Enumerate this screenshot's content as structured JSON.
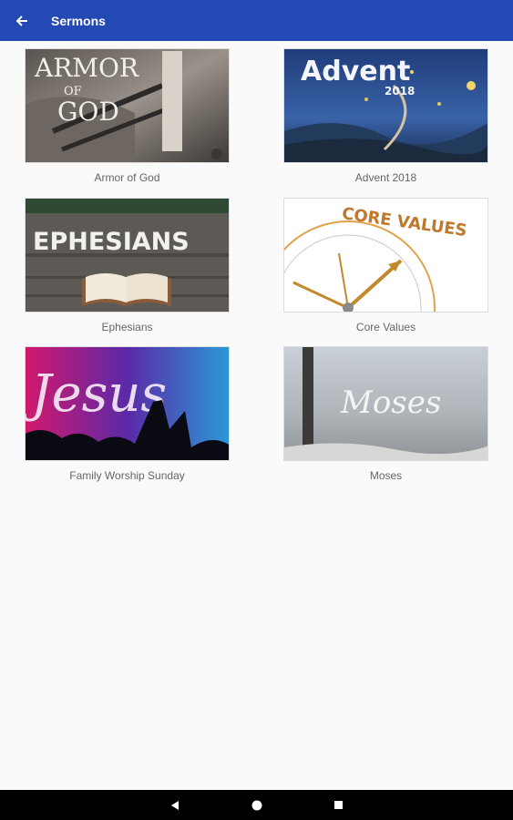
{
  "app_bar": {
    "title": "Sermons",
    "back_icon": "arrow-left-icon",
    "color": "#2349b4"
  },
  "sermons": [
    {
      "title": "Armor of God",
      "art_text": [
        "ARMOR",
        "OF",
        "GOD"
      ]
    },
    {
      "title": "Advent 2018",
      "art_text": [
        "Advent",
        "2018"
      ]
    },
    {
      "title": "Ephesians",
      "art_text": [
        "EPHESIANS"
      ]
    },
    {
      "title": "Core Values",
      "art_text": [
        "CORE VALUES"
      ]
    },
    {
      "title": "Family Worship Sunday",
      "art_text": [
        "Jesus"
      ]
    },
    {
      "title": "Moses",
      "art_text": [
        "Moses"
      ]
    }
  ],
  "nav_bar": {
    "buttons": [
      "back-triangle-icon",
      "home-circle-icon",
      "recents-square-icon"
    ]
  }
}
